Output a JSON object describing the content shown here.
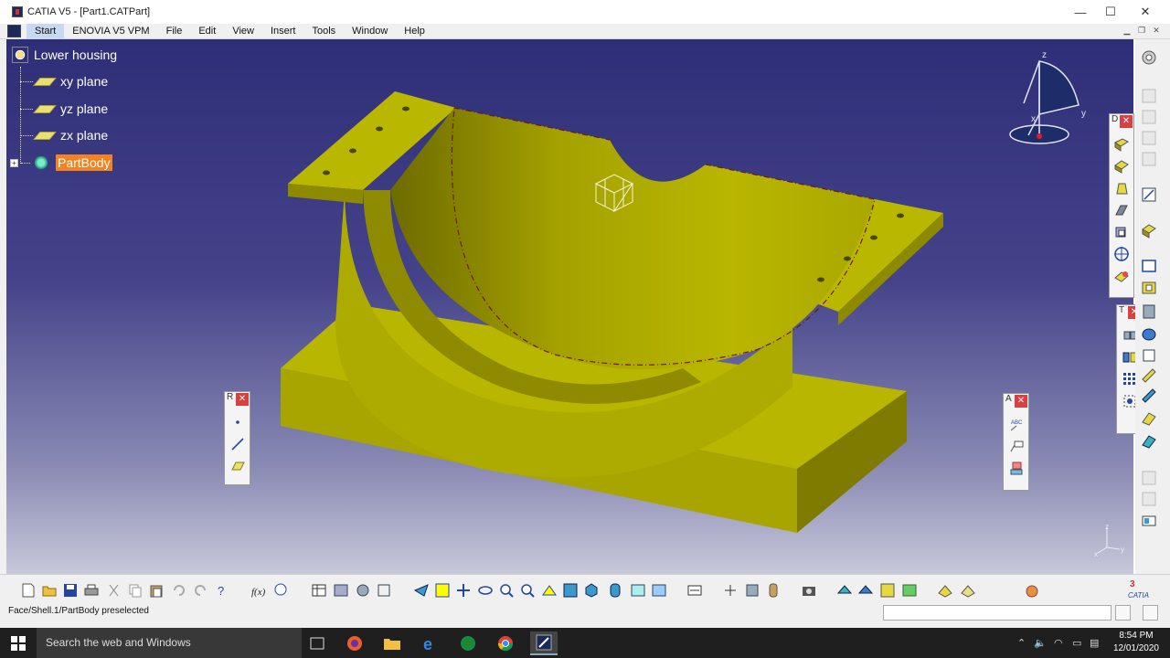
{
  "window": {
    "title": "CATIA V5 - [Part1.CATPart]",
    "minimize_glyph": "—",
    "maximize_glyph": "☐",
    "close_glyph": "✕"
  },
  "menubar": {
    "items": [
      {
        "label": "Start",
        "active": true
      },
      {
        "label": "ENOVIA V5 VPM",
        "active": false
      },
      {
        "label": "File",
        "active": false
      },
      {
        "label": "Edit",
        "active": false
      },
      {
        "label": "View",
        "active": false
      },
      {
        "label": "Insert",
        "active": false
      },
      {
        "label": "Tools",
        "active": false
      },
      {
        "label": "Window",
        "active": false
      },
      {
        "label": "Help",
        "active": false
      }
    ]
  },
  "tree": {
    "root": "Lower housing",
    "items": [
      {
        "label": "xy plane",
        "icon": "plane-icon"
      },
      {
        "label": "yz plane",
        "icon": "plane-icon"
      },
      {
        "label": "zx plane",
        "icon": "plane-icon"
      },
      {
        "label": "PartBody",
        "icon": "partbody-icon",
        "highlighted": true
      }
    ]
  },
  "compass": {
    "x_label": "x",
    "y_label": "y",
    "z_label": "z"
  },
  "mini_axis": {
    "x_label": "x",
    "y_label": "y",
    "z_label": "z"
  },
  "float_toolbars": {
    "reference": {
      "head": "R",
      "buttons": [
        "point-icon",
        "line-icon",
        "plane-icon"
      ]
    },
    "annotations": {
      "head": "A",
      "buttons": [
        "text-with-leader-icon",
        "flag-note-icon",
        "3d-annotation-icon"
      ]
    },
    "dress_up": {
      "head": "D",
      "buttons": [
        "fillet-icon",
        "chamfer-icon",
        "draft-icon",
        "shell-icon",
        "thickness-icon",
        "thread-icon",
        "remove-face-icon"
      ]
    },
    "transformation": {
      "head": "T",
      "buttons": [
        "translation-icon",
        "mirror-icon",
        "pattern-icon",
        "scaling-icon"
      ]
    }
  },
  "status": {
    "text": "Face/Shell.1/PartBody preselected"
  },
  "taskbar": {
    "search_placeholder": "Search the web and Windows",
    "time": "8:54 PM",
    "date": "12/01/2020"
  },
  "colors": {
    "part_fill": "#b5b200",
    "part_shadow": "#7f7c00",
    "part_light": "#cccb28",
    "highlight": "#f58220",
    "close_red": "#d94040"
  }
}
